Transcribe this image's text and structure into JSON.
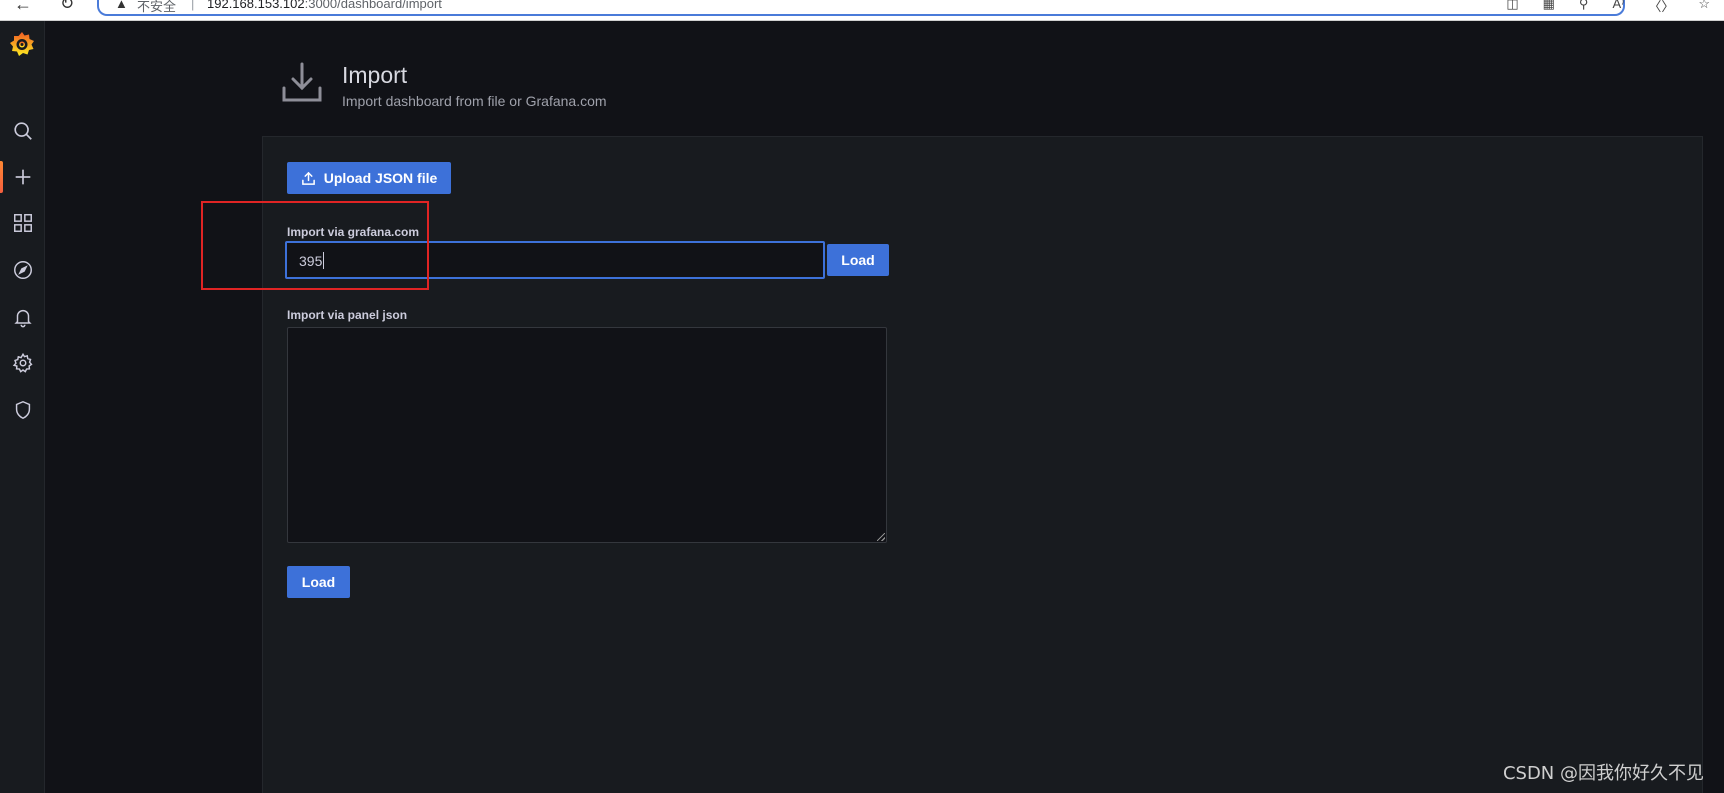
{
  "browser": {
    "security_label": "不安全",
    "separator": "|",
    "url_host": "192.168.153.102",
    "url_path": ":3000/dashboard/import"
  },
  "sidebar": {
    "items": [
      {
        "icon": "search-icon"
      },
      {
        "icon": "plus-icon",
        "active": true
      },
      {
        "icon": "dashboards-icon"
      },
      {
        "icon": "explore-icon"
      },
      {
        "icon": "bell-icon"
      },
      {
        "icon": "gear-icon"
      },
      {
        "icon": "shield-icon"
      }
    ]
  },
  "header": {
    "title": "Import",
    "subtitle": "Import dashboard from file or Grafana.com"
  },
  "upload": {
    "label": "Upload JSON file"
  },
  "grafana_com": {
    "label": "Import via grafana.com",
    "value": "395",
    "button": "Load"
  },
  "panel_json": {
    "label": "Import via panel json",
    "value": "",
    "button": "Load"
  },
  "colors": {
    "primary": "#3d71d9",
    "background": "#111217",
    "panel": "#181b1f",
    "annotation": "#e02424"
  },
  "watermark": "CSDN @因我你好久不见"
}
